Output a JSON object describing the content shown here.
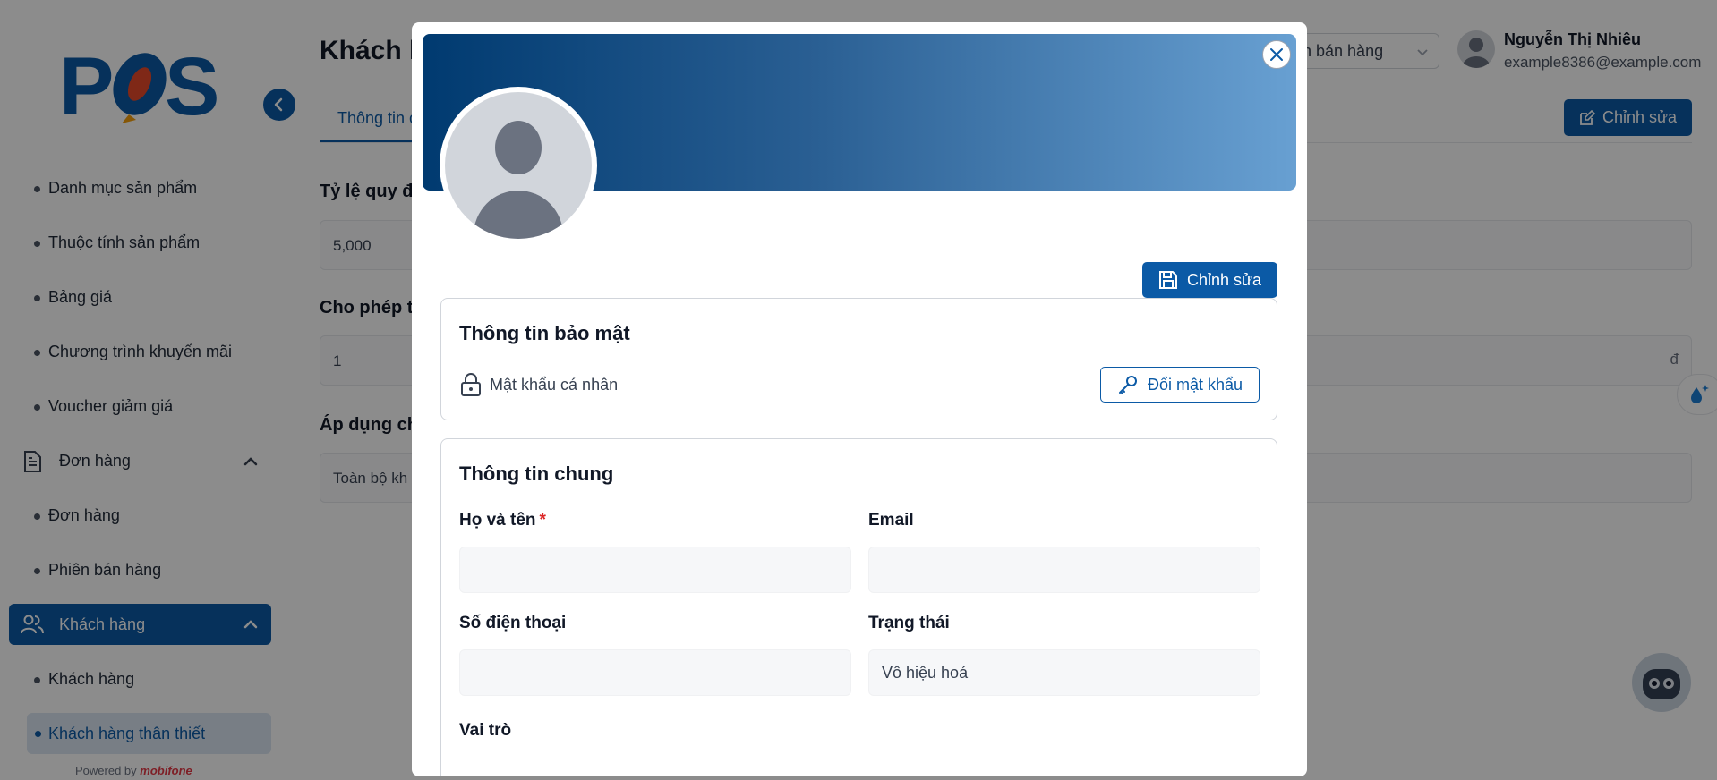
{
  "brand": {
    "logo_text": "POS",
    "powered_by": "Powered by",
    "powered_brand": "mobifone"
  },
  "sidebar": {
    "items": [
      {
        "type": "sub",
        "label": "Danh mục sản phẩm"
      },
      {
        "type": "sub",
        "label": "Thuộc tính sản phẩm"
      },
      {
        "type": "sub",
        "label": "Bảng giá"
      },
      {
        "type": "sub",
        "label": "Chương trình khuyến mãi"
      },
      {
        "type": "sub",
        "label": "Voucher giảm giá"
      },
      {
        "type": "group",
        "label": "Đơn hàng"
      },
      {
        "type": "sub",
        "label": "Đơn hàng"
      },
      {
        "type": "sub",
        "label": "Phiên bán hàng"
      },
      {
        "type": "group",
        "label": "Khách hàng",
        "active": true
      },
      {
        "type": "sub",
        "label": "Khách hàng"
      },
      {
        "type": "sub",
        "label": "Khách hàng thân thiết",
        "active": true
      }
    ]
  },
  "background": {
    "title": "Khách h",
    "tab": "Thông tin c",
    "label1": "Tỷ lệ quy đ",
    "value1": "5,000",
    "label2": "Cho phép t",
    "value2": "1",
    "currency": "đ",
    "label3": "Áp dụng ch",
    "value3": "Toàn bộ kh",
    "select_text": "n bán hàng",
    "edit_button": "Chỉnh sửa"
  },
  "user": {
    "name": "Nguyễn Thị Nhiêu",
    "email": "example8386@example.com"
  },
  "modal": {
    "save_button": "Chỉnh sửa",
    "security": {
      "title": "Thông tin bảo mật",
      "password_label": "Mật khẩu cá nhân",
      "change_password_button": "Đổi mật khẩu"
    },
    "general": {
      "title": "Thông tin chung",
      "full_name_label": "Họ và tên",
      "required_mark": "*",
      "full_name_value": "",
      "email_label": "Email",
      "email_value": "",
      "phone_label": "Số điện thoại",
      "phone_value": "",
      "status_label": "Trạng thái",
      "status_value": "Vô hiệu hoá",
      "role_label": "Vai trò"
    }
  },
  "colors": {
    "primary": "#0b5aa6",
    "banner_start": "#003a70",
    "banner_end": "#68a0d2",
    "required": "#dc2626"
  }
}
